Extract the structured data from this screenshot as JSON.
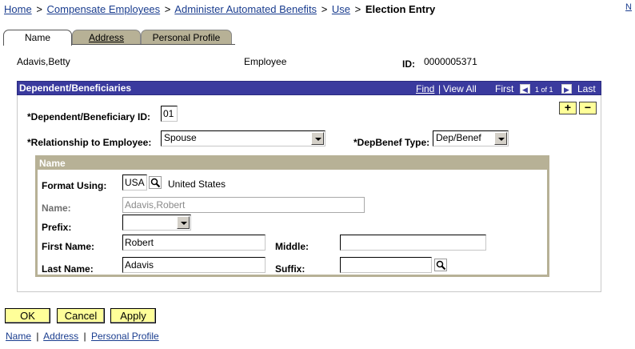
{
  "breadcrumb": {
    "items": [
      "Home",
      "Compensate Employees",
      "Administer Automated Benefits",
      "Use"
    ],
    "separator": ">",
    "current": "Election Entry"
  },
  "corner_link": "N",
  "tabs": [
    {
      "label": "Name",
      "active": true
    },
    {
      "label": "Address",
      "active": false
    },
    {
      "label": "Personal Profile",
      "active": false
    }
  ],
  "header": {
    "employee_name": "Adavis,Betty",
    "employee_type": "Employee",
    "id_label": "ID:",
    "id_value": "0000005371"
  },
  "scroll_area": {
    "title": "Dependent/Beneficiaries",
    "find_label": "Find",
    "divider": "|",
    "view_all_label": "View All",
    "first_label": "First",
    "prev_icon": "left-arrow-icon",
    "counter": "1 of 1",
    "next_icon": "right-arrow-icon",
    "last_label": "Last",
    "add_label": "+",
    "delete_label": "−"
  },
  "form": {
    "dependent_id_label": "*Dependent/Beneficiary ID:",
    "dependent_id_value": "01",
    "relationship_label": "*Relationship to Employee:",
    "relationship_value": "Spouse",
    "depbenef_type_label": "*DepBenef Type:",
    "depbenef_type_value": "Dep/Benef"
  },
  "name_group": {
    "title": "Name",
    "format_using_label": "Format Using:",
    "format_using_value": "USA",
    "format_using_description": "United States",
    "lookup_icon": "magnifier-icon",
    "name_label": "Name:",
    "name_value": "Adavis,Robert",
    "prefix_label": "Prefix:",
    "prefix_value": "",
    "first_name_label": "First Name:",
    "first_name_value": "Robert",
    "middle_label": "Middle:",
    "middle_value": "",
    "last_name_label": "Last Name:",
    "last_name_value": "Adavis",
    "suffix_label": "Suffix:",
    "suffix_value": ""
  },
  "buttons": {
    "ok": "OK",
    "cancel": "Cancel",
    "apply": "Apply"
  },
  "bottom_links": [
    "Name",
    "Address",
    "Personal Profile"
  ],
  "bottom_links_separator": "|",
  "colors": {
    "link": "#1a3d8f",
    "scroll_header": "#3a3a9e",
    "tab_inactive": "#b7b196",
    "group_border": "#b7b196",
    "button_yellow": "#ffff99"
  }
}
